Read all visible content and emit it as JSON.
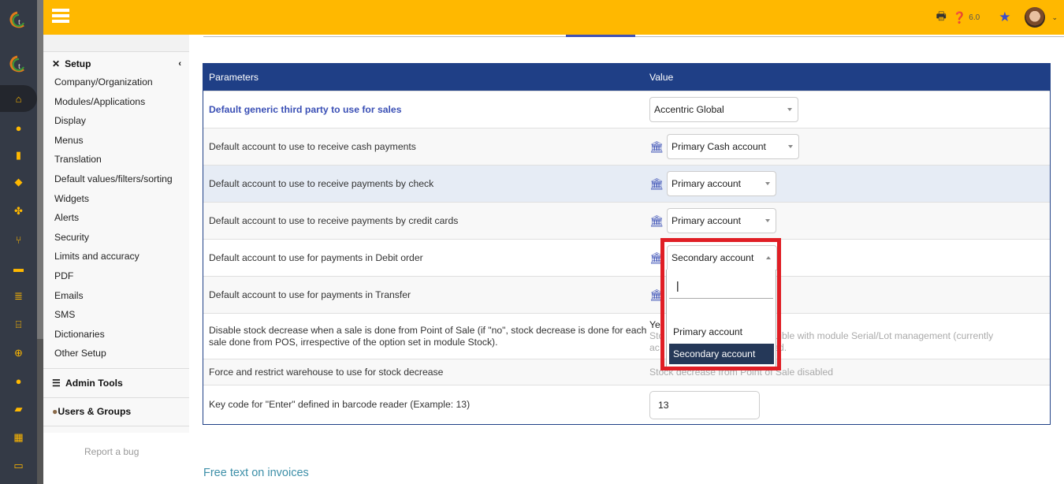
{
  "rail": {
    "icons": [
      "app-logo-icon",
      "app-logo-icon",
      "home-icon",
      "user-icon",
      "building-icon",
      "product-box-icon",
      "cubes-icon",
      "project-tree-icon",
      "briefcase-icon",
      "coins-icon",
      "bank-icon",
      "search-dollar-icon",
      "user-tie-icon",
      "folder-open-icon",
      "calendar-icon",
      "ticket-icon"
    ]
  },
  "topbar": {
    "version": "6.0",
    "icons": {
      "menu": "hamburger-icon",
      "print": "printer-icon",
      "help": "help-circle-icon",
      "bookmark": "star-icon",
      "user": "avatar",
      "dropdown": "chevron-down-icon"
    }
  },
  "menu": {
    "setup_title": "Setup",
    "setup_items": [
      "Company/Organization",
      "Modules/Applications",
      "Display",
      "Menus",
      "Translation",
      "Default values/filters/sorting",
      "Widgets",
      "Alerts",
      "Security",
      "Limits and accuracy",
      "PDF",
      "Emails",
      "SMS",
      "Dictionaries",
      "Other Setup"
    ],
    "admin_tools": "Admin Tools",
    "users_groups": "Users & Groups",
    "report_bug": "Report a bug"
  },
  "table": {
    "headers": {
      "param": "Parameters",
      "value": "Value"
    },
    "rows": [
      {
        "label": "Default generic third party to use for sales",
        "value": "Accentric Global"
      },
      {
        "label": "Default account to use to receive cash payments",
        "value": "Primary Cash account"
      },
      {
        "label": "Default account to use to receive payments by check",
        "value": "Primary account"
      },
      {
        "label": "Default account to use to receive payments by credit cards",
        "value": "Primary account"
      },
      {
        "label": "Default account to use for payments in Debit order",
        "value": "Secondary account"
      },
      {
        "label": "Default account to use for payments in Transfer",
        "value": ""
      },
      {
        "label": "Disable stock decrease when a sale is done from Point of Sale (if \"no\", stock decrease is done for each sale done from POS, irrespective of the option set in module Stock).",
        "value": "Ye",
        "note_line1": "Sto",
        "note_line1_end": "compatible with module Serial/Lot management (currently",
        "note_line2": "ac",
        "note_line2_end": "sabled."
      },
      {
        "label": "Force and restrict warehouse to use for stock decrease",
        "value": "Stock decrease from Point of Sale disabled"
      },
      {
        "label": "Key code for \"Enter\" defined in barcode reader (Example: 13)",
        "value": "13"
      }
    ]
  },
  "dropdown": {
    "search_value": "|",
    "options": [
      "Primary account",
      "Secondary account"
    ],
    "selected": "Secondary account"
  },
  "footer": {
    "section_link": "Free text on invoices"
  },
  "colors": {
    "topbar": "#ffb800",
    "rail": "#343a46",
    "header": "#1f3f86",
    "highlight": "#e01e25",
    "selected_option": "#253858"
  }
}
